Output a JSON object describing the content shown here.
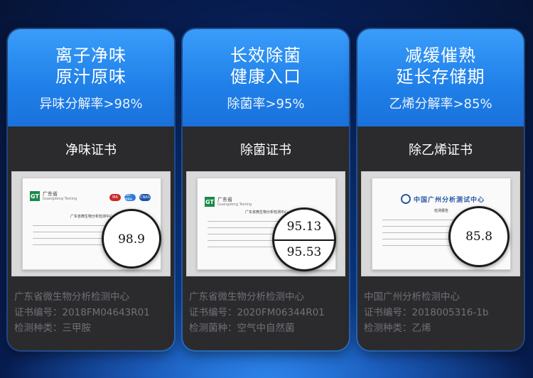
{
  "cards": [
    {
      "headline_line1": "离子净味",
      "headline_line2": "原汁原味",
      "rate": "异味分解率>98%",
      "cert_title": "净味证书",
      "cert_doc": {
        "org_logo": "广东省",
        "org_logo_sub": "Guangdong Testing",
        "heading": "广东省微生物分析检测中心",
        "badges": [
          "MA",
          "ilac-MRA",
          "CNAS"
        ]
      },
      "lens_values": [
        "98.9"
      ],
      "info": [
        "广东省微生物分析检测中心",
        "证书编号：2018FM04643R01",
        "检测种类：三甲胺"
      ]
    },
    {
      "headline_line1": "长效除菌",
      "headline_line2": "健康入口",
      "rate": "除菌率>95%",
      "cert_title": "除菌证书",
      "cert_doc": {
        "org_logo": "广东省",
        "org_logo_sub": "Guangdong Testing",
        "heading": "广东省微生物分析检测中心"
      },
      "lens_values": [
        "95.13",
        "95.53"
      ],
      "info": [
        "广东省微生物分析检测中心",
        "证书编号：2020FM06344R01",
        "检测菌种：空气中自然菌"
      ]
    },
    {
      "headline_line1": "减缓催熟",
      "headline_line2": "延长存储期",
      "rate": "乙烯分解率>85%",
      "cert_title": "除乙烯证书",
      "cert_doc": {
        "org_logo": "中国广州分析测试中心",
        "heading": "检测报告"
      },
      "lens_values": [
        "85.8"
      ],
      "info": [
        "中国广州分析检测中心",
        "证书编号：2018005316-1b",
        "检测种类：乙烯"
      ]
    }
  ],
  "colors": {
    "card_top": "#2a8ef2",
    "card_body": "#2b2b2e",
    "info_text": "#6f7177",
    "background": "#0a2a6e"
  }
}
